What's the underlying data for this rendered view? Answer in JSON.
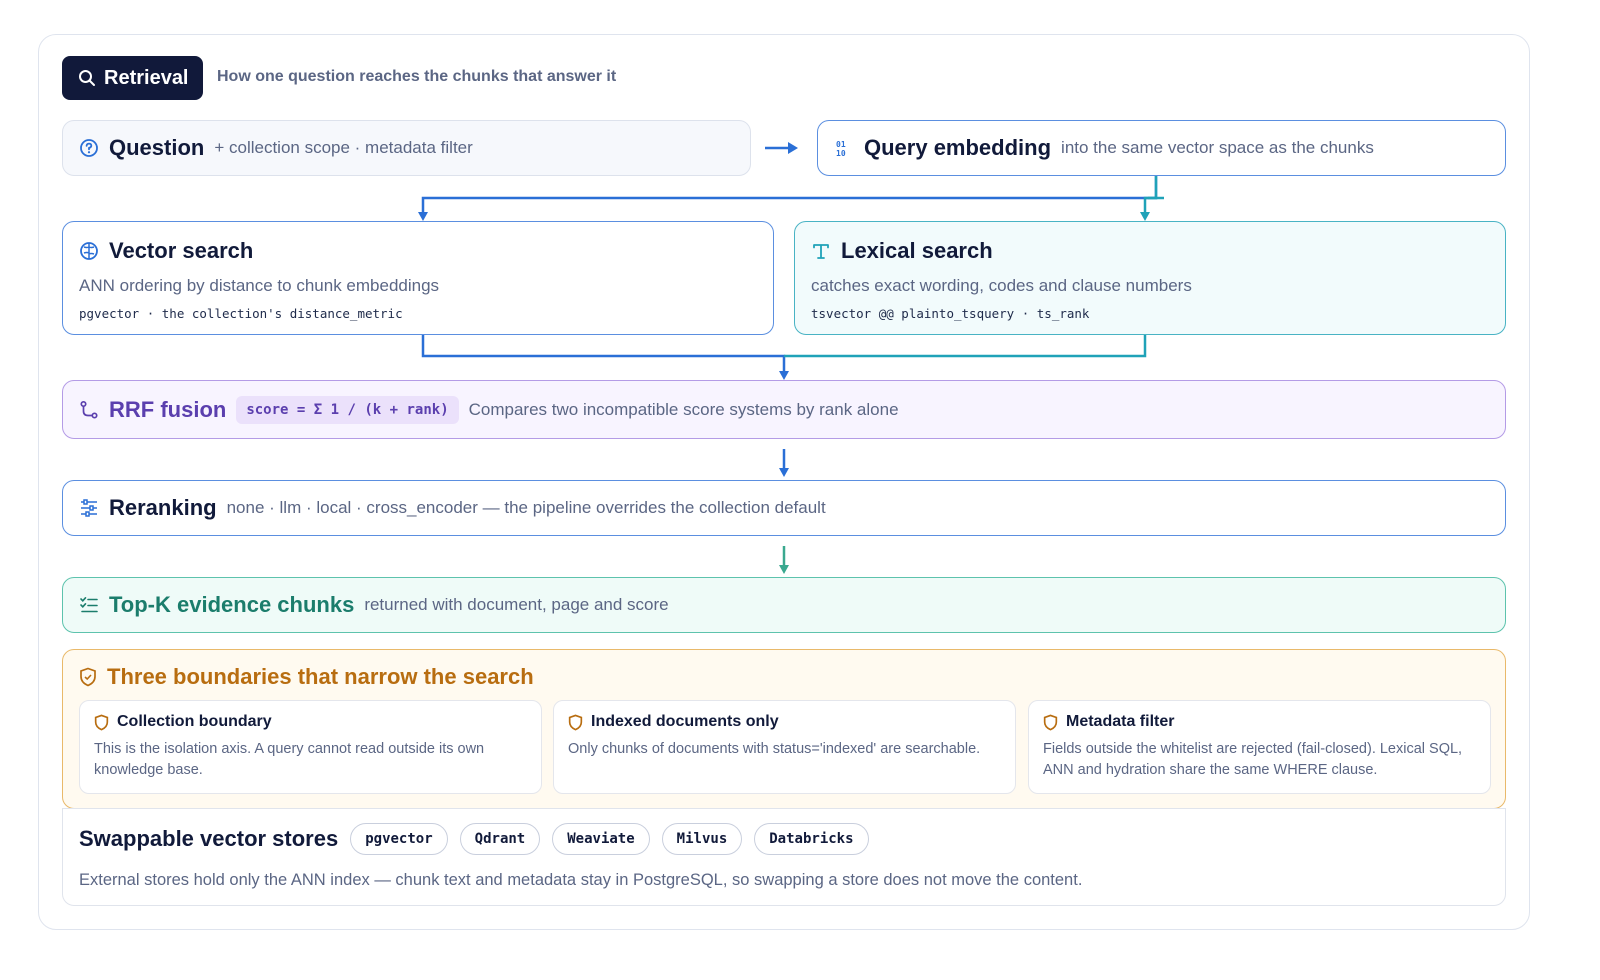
{
  "header": {
    "badge_label": "Retrieval",
    "subtitle": "How one question reaches the chunks that answer it"
  },
  "question": {
    "title": "Question",
    "subtitle": "+ collection scope · metadata filter"
  },
  "query_embedding": {
    "title": "Query embedding",
    "subtitle": "into the same vector space as the chunks"
  },
  "vector_search": {
    "title": "Vector search",
    "description": "ANN ordering by distance to chunk embeddings",
    "code": "pgvector · the collection's distance_metric"
  },
  "lexical_search": {
    "title": "Lexical search",
    "description": "catches exact wording, codes and clause numbers",
    "code": "tsvector @@ plainto_tsquery · ts_rank"
  },
  "rrf": {
    "title": "RRF fusion",
    "formula": "score = Σ 1 / (k + rank)",
    "subtitle": "Compares two incompatible score systems by rank alone"
  },
  "reranking": {
    "title": "Reranking",
    "subtitle": "none · llm · local · cross_encoder — the pipeline overrides the collection default"
  },
  "topk": {
    "title": "Top-K evidence chunks",
    "subtitle": "returned with document, page and score"
  },
  "boundaries": {
    "title": "Three boundaries that narrow the search",
    "items": [
      {
        "title": "Collection boundary",
        "text": "This is the isolation axis. A query cannot read outside its own knowledge base."
      },
      {
        "title": "Indexed documents only",
        "text": "Only chunks of documents with status='indexed' are searchable."
      },
      {
        "title": "Metadata filter",
        "text": "Fields outside the whitelist are rejected (fail-closed). Lexical SQL, ANN and hydration share the same WHERE clause."
      }
    ]
  },
  "stores": {
    "title": "Swappable vector stores",
    "chips": [
      "pgvector",
      "Qdrant",
      "Weaviate",
      "Milvus",
      "Databricks"
    ],
    "description": "External stores hold only the ANN index — chunk text and metadata stay in PostgreSQL, so swapping a store does not move the content."
  },
  "colors": {
    "navy": "#11193a",
    "blue": "#2a6fd6",
    "teal": "#1fa2b8",
    "purple": "#5b3fae",
    "green": "#1b7d6c",
    "amber": "#b86d10"
  },
  "icons": {
    "badge": "search-icon",
    "question": "question-circle-icon",
    "embedding": "binary-icon",
    "vector": "brain-icon",
    "lexical": "text-type-icon",
    "rrf": "merge-route-icon",
    "reranking": "sliders-icon",
    "topk": "checklist-icon",
    "boundaries": "shield-icon"
  }
}
